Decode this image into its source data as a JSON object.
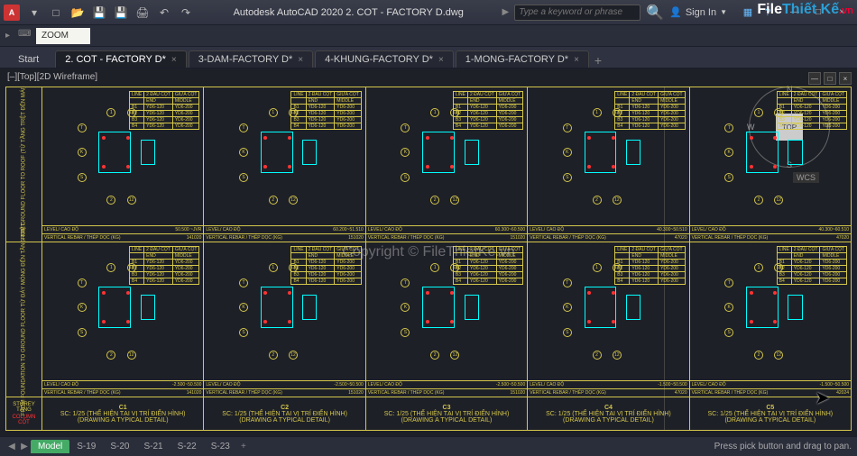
{
  "app": {
    "icon_letter": "A",
    "title": "Autodesk AutoCAD 2020   2. COT - FACTORY D.dwg",
    "search_placeholder": "Type a keyword or phrase",
    "signin": "Sign In"
  },
  "qat": {
    "menu": "▾",
    "new": "□",
    "open": "📂",
    "save": "💾",
    "saveas": "💾",
    "plot": "🖨",
    "undo": "↶",
    "redo": "↷"
  },
  "cmd": {
    "value": "ZOOM"
  },
  "tabs": {
    "start": "Start",
    "files": [
      {
        "label": "2. COT - FACTORY D*",
        "active": true
      },
      {
        "label": "3-DAM-FACTORY D*",
        "active": false
      },
      {
        "label": "4-KHUNG-FACTORY D*",
        "active": false
      },
      {
        "label": "1-MONG-FACTORY D*",
        "active": false
      }
    ],
    "add": "+"
  },
  "viewport": {
    "label": "[–][Top][2D Wireframe]",
    "vc_min": "—",
    "vc_max": "□",
    "vc_close": "×"
  },
  "viewcube": {
    "face": "TOP",
    "n": "N",
    "s": "S",
    "e": "E",
    "w": "W",
    "wcs": "WCS"
  },
  "drawing": {
    "rows": [
      {
        "label": "FROM GROUND FLOOR TO ROOF\n(TỪ TẦNG TRỆT ĐẾN MÁI)"
      },
      {
        "label": "FROM FOUNDATION TO GROUND FLOOR\nTỪ ĐÁY MÓNG ĐẾN TẦNG TRỆT"
      }
    ],
    "storey_header": "STOREY\nTẦNG",
    "column_header": "COLUMN\nCỘT",
    "mini_table_header": [
      "LINE",
      "2 ĐẦU CỘT",
      "GIỮA CỘT"
    ],
    "mini_table_sub": [
      "",
      "END",
      "MIDDLE"
    ],
    "mini_table_rows": [
      [
        "B1",
        "YD6-120",
        "YD6-200"
      ],
      [
        "B2",
        "YD6-120",
        "YD6-200"
      ],
      [
        "B3",
        "YD6-120",
        "YD6-200"
      ],
      [
        "B4",
        "YD6-120",
        "YD6-200"
      ]
    ],
    "level_row_label": "LEVEL/ CAO ĐỘ",
    "rebar_row_label": "VERTICAL REBAR / THÉP DỌC (KG)",
    "level_values_top": [
      "50.500 ~JVR",
      "60.200~51.510",
      "60.300~60.500",
      "40.300~50.510",
      "40.300~60.510"
    ],
    "rebar_values_top": [
      "141020",
      "151020",
      "151020",
      "47020",
      "47020"
    ],
    "level_values_bot": [
      "-2.500~50.500",
      "-2.500~50.500",
      "-2.500~50.500",
      "-1.500~50.500",
      "-1.500~50.500"
    ],
    "rebar_values_bot": [
      "141020",
      "151020",
      "151020",
      "47020",
      "42024"
    ],
    "columns": [
      {
        "name": "C1",
        "note": "SC: 1/25 (THỂ HIỆN TẠI VỊ TRÍ ĐIỂN HÌNH)",
        "note2": "(DRAWING A TYPICAL DETAIL)"
      },
      {
        "name": "C2",
        "note": "SC: 1/25 (THỂ HIỆN TẠI VỊ TRÍ ĐIỂN HÌNH)",
        "note2": "(DRAWING A TYPICAL DETAIL)"
      },
      {
        "name": "C3",
        "note": "SC: 1/25 (THỂ HIỆN TẠI VỊ TRÍ ĐIỂN HÌNH)",
        "note2": "(DRAWING A TYPICAL DETAIL)"
      },
      {
        "name": "C4",
        "note": "SC: 1/25 (THỂ HIỆN TẠI VỊ TRÍ ĐIỂN HÌNH)",
        "note2": "(DRAWING A TYPICAL DETAIL)"
      },
      {
        "name": "C5",
        "note": "SC: 1/25 (THỂ HIỆN TẠI VỊ TRÍ ĐIỂN HÌNH)",
        "note2": "(DRAWING A TYPICAL DETAIL)"
      }
    ],
    "axis_marks": [
      "T",
      "K",
      "S",
      "1",
      "2",
      "3",
      "4",
      "12",
      "13"
    ]
  },
  "status": {
    "model": "Model",
    "layouts": [
      "S-19",
      "S-20",
      "S-21",
      "S-22",
      "S-23"
    ],
    "hint": "Press pick button and drag to pan."
  },
  "watermark": "Copyright © FileThietKe.vn",
  "logo": {
    "a": "File",
    "b": "Thiết Kế",
    "c": ".vn"
  }
}
